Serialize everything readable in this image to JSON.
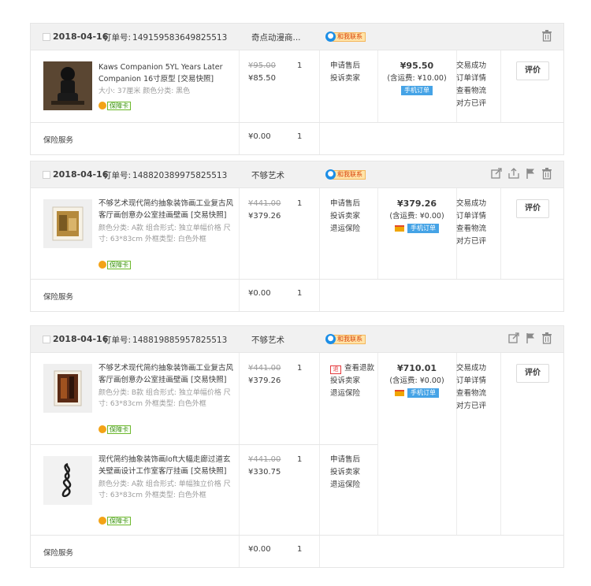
{
  "labels": {
    "order_no": "订单号:",
    "rate_button": "评价",
    "insurance": "保险服务",
    "contact_badge": "和我联系",
    "guarantee_badge": "保障卡",
    "mobile_order": "手机订单",
    "refund_icon_glyph": "退"
  },
  "colors": {
    "header_bg": "#f1f1f1",
    "border": "#e6e6e6",
    "contact_blue": "#1c8ee6",
    "contact_orange_bg": "#ffe4a9",
    "mobile_tag_blue": "#45a3e6",
    "refund_red": "#e4393c"
  },
  "orders": [
    {
      "date": "2018-04-16",
      "order_no": "149159583649825513",
      "shop": "奇点动漫商...",
      "header_icons": [
        "trash-icon"
      ],
      "items": [
        {
          "title": "Kaws Companion 5YL Years Later Companion 16寸原型 [交易快照]",
          "meta": "大小: 37厘米  颜色分类: 黑色",
          "orig_price": "¥95.00",
          "price": "¥85.50",
          "qty": "1",
          "services": [
            "申请售后",
            "投诉卖家"
          ]
        }
      ],
      "total": "¥95.50",
      "shipping": "(含运费: ¥10.00)",
      "has_card_icon": false,
      "status": [
        "交易成功",
        "订单详情",
        "查看物流",
        "对方已评"
      ],
      "insurance_price": "¥0.00",
      "insurance_qty": "1"
    },
    {
      "date": "2018-04-16",
      "order_no": "148820389975825513",
      "shop": "不够艺术",
      "header_icons": [
        "share-icon",
        "upload-icon",
        "flag-icon",
        "trash-icon"
      ],
      "items": [
        {
          "title": "不够艺术现代简约抽象装饰画工业复古风客厅画创意办公室挂画壁画 [交易快照]",
          "meta": "颜色分类: A款  组合形式: 独立单幅价格  尺寸: 63*83cm  外框类型: 白色外框",
          "orig_price": "¥441.00",
          "price": "¥379.26",
          "qty": "1",
          "services": [
            "申请售后",
            "投诉卖家",
            "退运保险"
          ]
        }
      ],
      "total": "¥379.26",
      "shipping": "(含运费: ¥0.00)",
      "has_card_icon": true,
      "status": [
        "交易成功",
        "订单详情",
        "查看物流",
        "对方已评"
      ],
      "insurance_price": "¥0.00",
      "insurance_qty": "1"
    },
    {
      "date": "2018-04-16",
      "order_no": "148819885957825513",
      "shop": "不够艺术",
      "header_icons": [
        "share-icon",
        "flag-icon",
        "trash-icon"
      ],
      "items": [
        {
          "title": "不够艺术现代简约抽象装饰画工业复古风客厅画创意办公室挂画壁画 [交易快照]",
          "meta": "颜色分类: B款  组合形式: 独立单幅价格  尺寸: 63*83cm  外框类型: 白色外框",
          "orig_price": "¥441.00",
          "price": "¥379.26",
          "qty": "1",
          "services": [
            "查看退款",
            "投诉卖家",
            "退运保险"
          ]
        },
        {
          "title": "现代简约抽象装饰画loft大幅走廊过道玄关壁画设计工作室客厅挂画 [交易快照]",
          "meta": "颜色分类: A款  组合形式: 单幅独立价格  尺寸: 63*83cm  外框类型: 白色外框",
          "orig_price": "¥441.00",
          "price": "¥330.75",
          "qty": "1",
          "services": [
            "申请售后",
            "投诉卖家",
            "退运保险"
          ]
        }
      ],
      "total": "¥710.01",
      "shipping": "(含运费: ¥0.00)",
      "has_card_icon": true,
      "status": [
        "交易成功",
        "订单详情",
        "查看物流",
        "对方已评"
      ],
      "insurance_price": "¥0.00",
      "insurance_qty": "1"
    }
  ]
}
